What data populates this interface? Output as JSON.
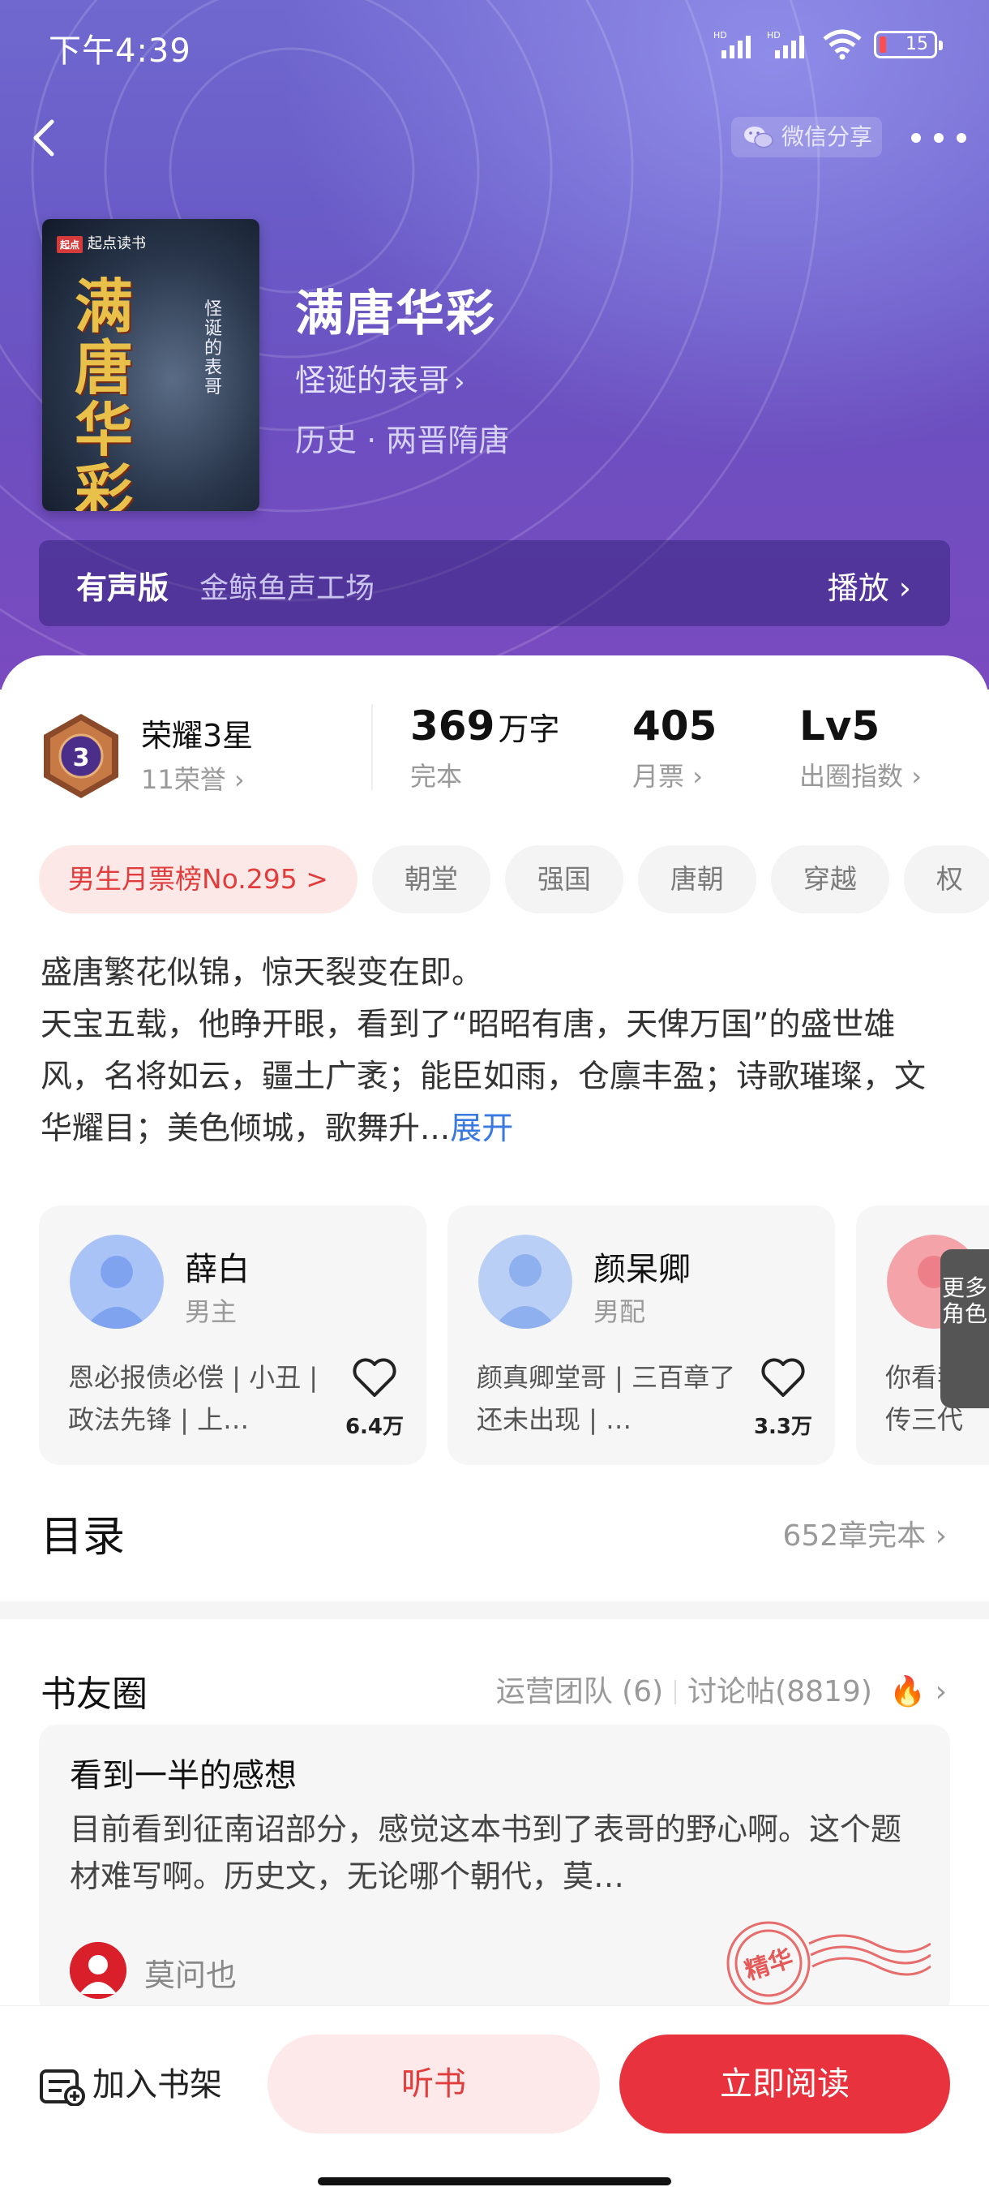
{
  "status_bar": {
    "time": "下午4:39",
    "battery": "15"
  },
  "nav": {
    "share_label": "微信分享"
  },
  "book": {
    "title": "满唐华彩",
    "author": "怪诞的表哥",
    "genre": "历史 · 两晋隋唐",
    "cover_publisher": "起点读书",
    "cover_title": "满唐华彩",
    "cover_author": "怪诞的表哥"
  },
  "audio": {
    "label": "有声版",
    "studio": "金鲸鱼声工场",
    "play": "播放"
  },
  "honor": {
    "title": "荣耀3星",
    "level": "3",
    "subtitle": "11荣誉"
  },
  "stats": [
    {
      "num": "369",
      "unit": "万字",
      "label": "完本"
    },
    {
      "num": "405",
      "unit": "",
      "label": "月票"
    },
    {
      "num": "Lv5",
      "unit": "",
      "label": "出圈指数"
    }
  ],
  "tags": [
    "男生月票榜No.295 >",
    "朝堂",
    "强国",
    "唐朝",
    "穿越",
    "权"
  ],
  "intro": {
    "line1": "盛唐繁花似锦，惊天裂变在即。",
    "line2": "天宝五载，他睁开眼，看到了“昭昭有唐，天俾万国”的盛世雄风，名将如云，疆土广袤；能臣如雨，仓廪丰盈；诗歌璀璨，文华耀目；美色倾城，歌舞升...",
    "expand": "展开"
  },
  "roles": [
    {
      "name": "薛白",
      "type": "男主",
      "desc": "恩必报债必偿 | 小丑 | 政法先锋 | 上…",
      "likes": "6.4万"
    },
    {
      "name": "颜杲卿",
      "type": "男配",
      "desc": "颜真卿堂哥 | 三百章了还未出现 | …",
      "likes": "3.3万"
    },
    {
      "name": "",
      "type": "",
      "desc": "你看我千传三代",
      "likes": ""
    }
  ],
  "more_roles": "更多角色",
  "toc": {
    "title": "目录",
    "status": "652章完本"
  },
  "circle": {
    "title": "书友圈",
    "team": "运营团队 (6)",
    "posts": "讨论帖(8819)"
  },
  "post": {
    "title": "看到一半的感想",
    "body": "目前看到征南诏部分，感觉这本书到了表哥的野心啊。这个题材难写啊。历史文，无论哪个朝代，莫…",
    "user": "莫问也",
    "stamp": "精华"
  },
  "bottom": {
    "shelf": "加入书架",
    "listen": "听书",
    "read": "立即阅读"
  },
  "colors": {
    "accent": "#e8323d",
    "hero": "#6a5cc8",
    "link": "#3a79e0"
  }
}
